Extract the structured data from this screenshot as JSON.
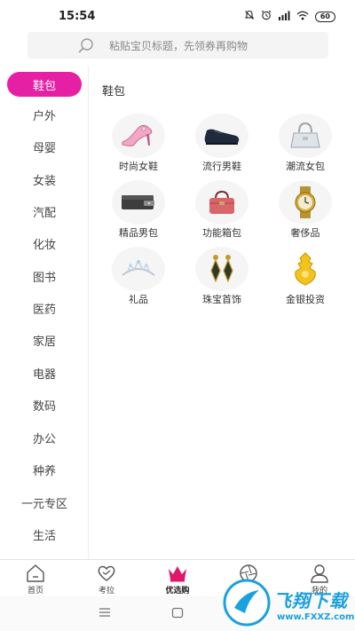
{
  "status_bar": {
    "time": "15:54",
    "battery": "60"
  },
  "search": {
    "placeholder": "粘贴宝贝标题，先领券再购物"
  },
  "sidebar": {
    "items": [
      {
        "label": "鞋包",
        "active": true
      },
      {
        "label": "户外"
      },
      {
        "label": "母婴"
      },
      {
        "label": "女装"
      },
      {
        "label": "汽配"
      },
      {
        "label": "化妆"
      },
      {
        "label": "图书"
      },
      {
        "label": "医药"
      },
      {
        "label": "家居"
      },
      {
        "label": "电器"
      },
      {
        "label": "数码"
      },
      {
        "label": "办公"
      },
      {
        "label": "种养"
      },
      {
        "label": "一元专区"
      },
      {
        "label": "生活"
      }
    ]
  },
  "content": {
    "title": "鞋包",
    "items": [
      {
        "label": "时尚女鞋",
        "icon": "high-heel-icon"
      },
      {
        "label": "流行男鞋",
        "icon": "mens-shoe-icon"
      },
      {
        "label": "潮流女包",
        "icon": "handbag-icon"
      },
      {
        "label": "精品男包",
        "icon": "wallet-icon"
      },
      {
        "label": "功能箱包",
        "icon": "travel-bag-icon"
      },
      {
        "label": "奢侈品",
        "icon": "watch-icon"
      },
      {
        "label": "礼品",
        "icon": "tiara-icon"
      },
      {
        "label": "珠宝首饰",
        "icon": "earrings-icon"
      },
      {
        "label": "金银投资",
        "icon": "gold-ornament-icon"
      }
    ]
  },
  "tabbar": {
    "tabs": [
      {
        "label": "首页",
        "icon": "home-icon"
      },
      {
        "label": "考拉",
        "icon": "heart-icon"
      },
      {
        "label": "优选购",
        "icon": "crown-icon",
        "active": true
      },
      {
        "label": "",
        "icon": "shutter-icon"
      },
      {
        "label": "我的",
        "icon": "user-icon"
      }
    ],
    "active_color": "#e0186a"
  },
  "watermark": {
    "text": "飞翔下载",
    "url": "www.FXXZ.com"
  },
  "colors": {
    "accent": "#e620a5"
  }
}
